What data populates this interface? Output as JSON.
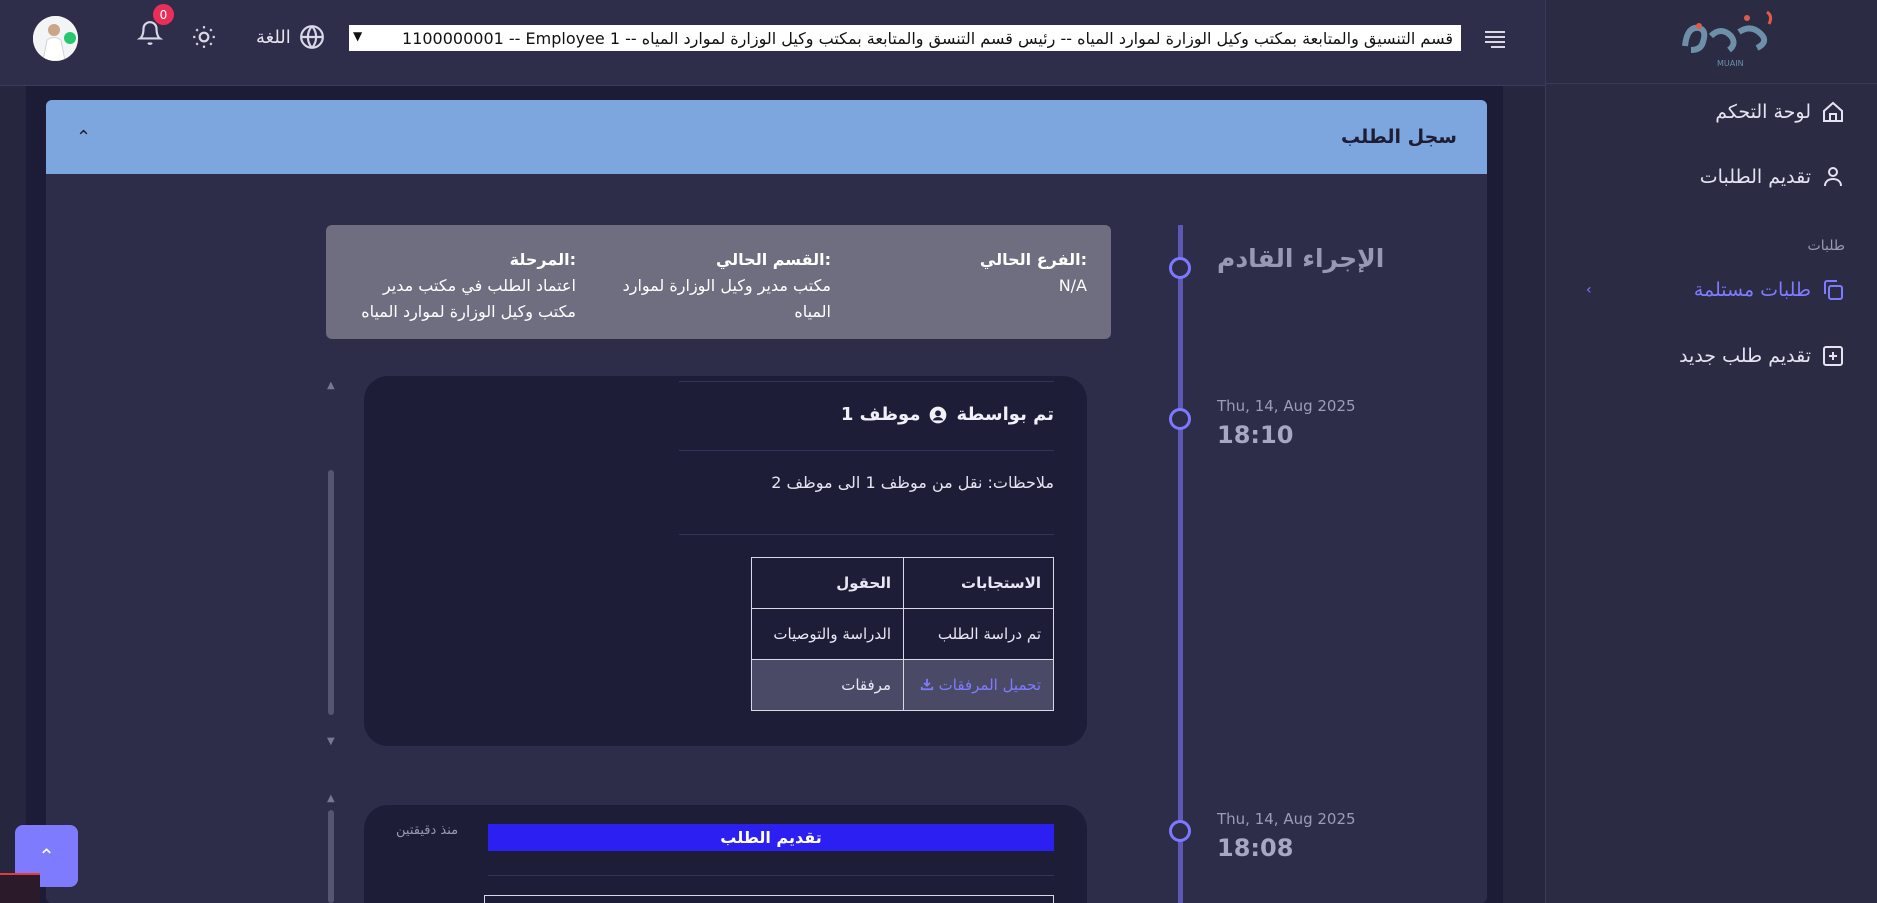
{
  "colors": {
    "accent": "#7f7bff",
    "header_blue": "#7ea6de",
    "badge_red": "#ea2e5a",
    "submit_blue": "#2b1ff2"
  },
  "topbar": {
    "notifications_count": "0",
    "language_label": "اللغة",
    "role_select_value": "1100000001 -- Employee 1 -- قسم التنسيق والمتابعة بمكتب وكيل الوزارة لموارد المياه -- رئيس قسم التنسق والمتابعة بمكتب وكيل الوزارة لموارد المياه"
  },
  "sidebar": {
    "logo_text": "MUAIN",
    "items": [
      {
        "label": "لوحة التحكم",
        "icon": "home-icon"
      },
      {
        "label": "تقديم الطلبات",
        "icon": "user-icon"
      }
    ],
    "section_label": "طلبات",
    "section_items": [
      {
        "label": "طلبات مستلمة",
        "icon": "copy-icon"
      },
      {
        "label": "تقديم طلب جديد",
        "icon": "plus-square-icon"
      }
    ]
  },
  "card": {
    "title": "سجل الطلب"
  },
  "timeline": {
    "next_label": "الإجراء القادم",
    "entries": [
      {
        "date": "Thu, 14, Aug 2025",
        "time": "18:10"
      },
      {
        "date": "Thu, 14, Aug 2025",
        "time": "18:08"
      }
    ]
  },
  "info": {
    "branch_label": "الفرع الحالي:",
    "branch_value": "N/A",
    "dept_label": "القسم الحالي:",
    "dept_value_1": "مكتب مدير وكيل الوزارة لموارد",
    "dept_value_2": "المياه",
    "stage_label": "المرحلة:",
    "stage_value_1": "اعتماد الطلب في مكتب مدير",
    "stage_value_2": "مكتب وكيل الوزارة لموارد المياه"
  },
  "entry1": {
    "by_label": "تم بواسطة",
    "by_user": "موظف 1",
    "notes": "ملاحظات: نقل من موظف 1 الى موظف 2",
    "table_headers": [
      "الحقول",
      "الاستجابات"
    ],
    "rows": [
      {
        "field": "الدراسة والتوصيات",
        "response": "تم دراسة الطلب"
      },
      {
        "field": "مرفقات",
        "response": "تحميل المرفقات"
      }
    ]
  },
  "entry2": {
    "action_label": "تقديم الطلب",
    "ago": "منذ دقيقتين"
  }
}
